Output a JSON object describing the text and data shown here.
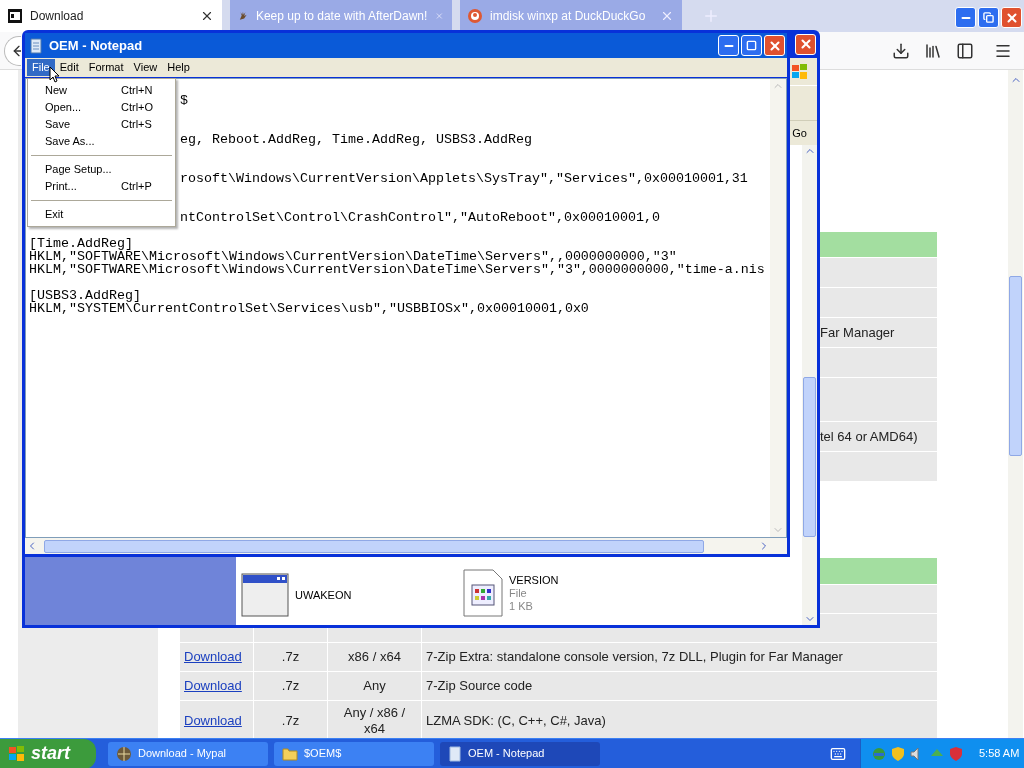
{
  "browser": {
    "tabs": [
      {
        "title": "Download",
        "selected": true,
        "kind": "archive"
      },
      {
        "title": "Keep up to date with AfterDawn!",
        "selected": false,
        "kind": "hand"
      },
      {
        "title": "imdisk winxp at DuckDuckGo",
        "selected": false,
        "kind": "duck"
      }
    ],
    "table_1": {
      "rows": [
        {
          "kind": "header"
        },
        {
          "kind": "single"
        },
        {
          "kind": "single"
        },
        {
          "kind": "single",
          "column_4": "Far Manager"
        },
        {
          "kind": "single"
        },
        {
          "kind": "double"
        },
        {
          "kind": "single",
          "column_4": "tel 64 or AMD64)"
        },
        {
          "kind": "single"
        }
      ]
    },
    "table_2": {
      "rows": [
        {
          "kind": "header"
        },
        {
          "kind": "single"
        },
        {
          "kind": "single"
        },
        {
          "kind": "single",
          "link": "Download",
          "format": ".7z",
          "arch": "x86 / x64",
          "description": "7-Zip Extra: standalone console version, 7z DLL, Plugin for Far Manager"
        },
        {
          "kind": "single",
          "link": "Download",
          "format": ".7z",
          "arch": "Any",
          "description": "7-Zip Source code"
        },
        {
          "kind": "double",
          "link": "Download",
          "format": ".7z",
          "arch": "Any / x86 / x64",
          "description": "LZMA SDK: (C, C++, C#, Java)"
        }
      ]
    }
  },
  "explorer": {
    "go": "Go",
    "files": [
      {
        "kind": "app",
        "name": "UWAKEON"
      },
      {
        "kind": "file",
        "name": "VERSION",
        "type": "File",
        "size": "1 KB"
      }
    ]
  },
  "notepad": {
    "title": "OEM - Notepad",
    "menus": [
      {
        "label": "File",
        "selected": true
      },
      {
        "label": "Edit",
        "selected": false
      },
      {
        "label": "Format",
        "selected": false
      },
      {
        "label": "View",
        "selected": false
      },
      {
        "label": "Help",
        "selected": false
      }
    ],
    "lines": [
      {
        "kind": "blank"
      },
      {
        "kind": "partial",
        "text": "$"
      },
      {
        "kind": "blank"
      },
      {
        "kind": "blank"
      },
      {
        "kind": "partial",
        "text": "eg, Reboot.AddReg, Time.AddReg, USBS3.AddReg"
      },
      {
        "kind": "blank"
      },
      {
        "kind": "blank"
      },
      {
        "kind": "partial",
        "text": "rosoft\\Windows\\CurrentVersion\\Applets\\SysTray\",\"Services\",0x00010001,31"
      },
      {
        "kind": "blank"
      },
      {
        "kind": "blank"
      },
      {
        "kind": "partial",
        "text": "ntControlSet\\Control\\CrashControl\",\"AutoReboot\",0x00010001,0"
      },
      {
        "kind": "blank"
      },
      {
        "kind": "full",
        "text": "[Time.AddReg]"
      },
      {
        "kind": "full",
        "text": "HKLM,\"SOFTWARE\\Microsoft\\Windows\\CurrentVersion\\DateTime\\Servers\",,0000000000,\"3\""
      },
      {
        "kind": "full",
        "text": "HKLM,\"SOFTWARE\\Microsoft\\Windows\\CurrentVersion\\DateTime\\Servers\",\"3\",0000000000,\"time-a.nis"
      },
      {
        "kind": "blank"
      },
      {
        "kind": "full",
        "text": "[USBS3.AddReg]"
      },
      {
        "kind": "full",
        "text": "HKLM,\"SYSTEM\\CurrentControlSet\\Services\\usb\",\"USBBIOSx\",0x00010001,0x0"
      }
    ],
    "file_menu": [
      {
        "kind": "item",
        "label": "New",
        "shortcut": "Ctrl+N"
      },
      {
        "kind": "item",
        "label": "Open...",
        "shortcut": "Ctrl+O"
      },
      {
        "kind": "item",
        "label": "Save",
        "shortcut": "Ctrl+S"
      },
      {
        "kind": "item",
        "label": "Save As..."
      },
      {
        "kind": "separator"
      },
      {
        "kind": "item",
        "label": "Page Setup..."
      },
      {
        "kind": "item",
        "label": "Print...",
        "shortcut": "Ctrl+P"
      },
      {
        "kind": "separator"
      },
      {
        "kind": "item",
        "label": "Exit"
      }
    ]
  },
  "taskbar": {
    "start": "start",
    "tasks": [
      {
        "kind": "browser",
        "label": "Download - Mypal",
        "selected": false
      },
      {
        "kind": "folder",
        "label": "$OEM$",
        "selected": false
      },
      {
        "kind": "notepad",
        "label": "OEM - Notepad",
        "selected": true
      }
    ],
    "clock": "5:58 AM"
  }
}
